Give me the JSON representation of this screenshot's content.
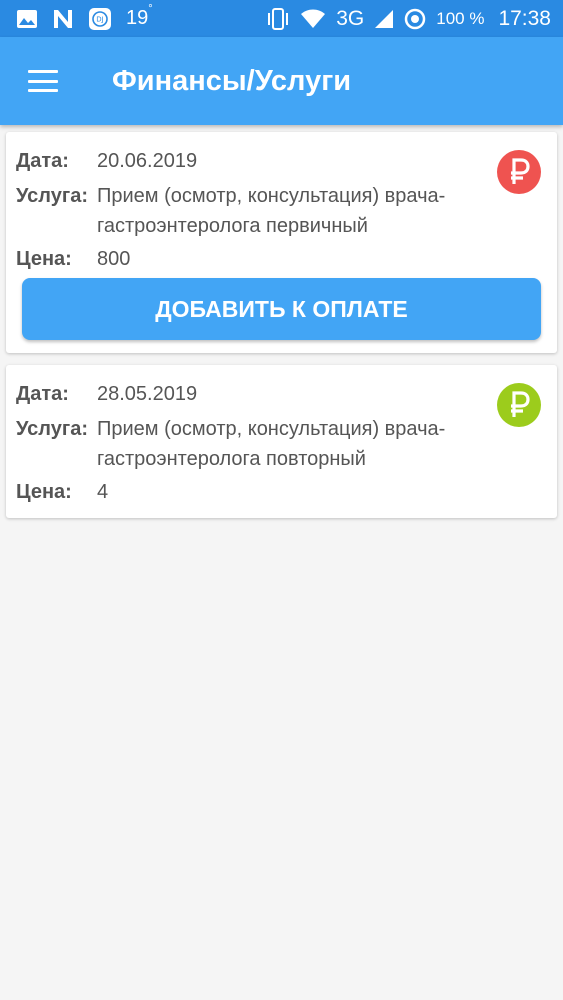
{
  "status_bar": {
    "temperature": "19",
    "temperature_unit": "°",
    "network": "3G",
    "battery": "100 %",
    "time": "17:38",
    "icons": [
      "image-icon",
      "n-app-icon",
      "app-notification-icon",
      "vibrate-icon",
      "wifi-icon",
      "signal-icon",
      "location-target-icon"
    ]
  },
  "app_bar": {
    "title": "Финансы/Услуги",
    "menu_icon": "hamburger-menu-icon"
  },
  "colors": {
    "status_bar": "#2a8ae2",
    "app_bar": "#42a5f5",
    "unpaid": "#ef5350",
    "paid": "#9ccc1c"
  },
  "services": [
    {
      "date_label": "Дата:",
      "date": "20.06.2019",
      "service_label": "Услуга:",
      "service": "Прием (осмотр, консультация) врача-гастроэнтеролога первичный",
      "price_label": "Цена:",
      "price": "800",
      "status_icon": "ruble-unpaid-icon",
      "status_color": "#ef5350",
      "button_label": "ДОБАВИТЬ К ОПЛАТЕ"
    },
    {
      "date_label": "Дата:",
      "date": "28.05.2019",
      "service_label": "Услуга:",
      "service": "Прием (осмотр, консультация) врача-гастроэнтеролога повторный",
      "price_label": "Цена:",
      "price": "4",
      "status_icon": "ruble-paid-icon",
      "status_color": "#9ccc1c"
    }
  ]
}
